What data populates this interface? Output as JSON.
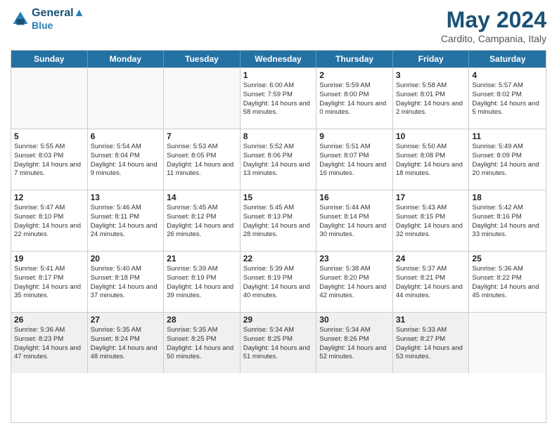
{
  "header": {
    "logo_line1": "General",
    "logo_line2": "Blue",
    "month_year": "May 2024",
    "location": "Cardito, Campania, Italy"
  },
  "days_of_week": [
    "Sunday",
    "Monday",
    "Tuesday",
    "Wednesday",
    "Thursday",
    "Friday",
    "Saturday"
  ],
  "weeks": [
    [
      {
        "day": "",
        "info": ""
      },
      {
        "day": "",
        "info": ""
      },
      {
        "day": "",
        "info": ""
      },
      {
        "day": "1",
        "info": "Sunrise: 6:00 AM\nSunset: 7:59 PM\nDaylight: 14 hours\nand 58 minutes."
      },
      {
        "day": "2",
        "info": "Sunrise: 5:59 AM\nSunset: 8:00 PM\nDaylight: 14 hours\nand 0 minutes."
      },
      {
        "day": "3",
        "info": "Sunrise: 5:58 AM\nSunset: 8:01 PM\nDaylight: 14 hours\nand 2 minutes."
      },
      {
        "day": "4",
        "info": "Sunrise: 5:57 AM\nSunset: 8:02 PM\nDaylight: 14 hours\nand 5 minutes."
      }
    ],
    [
      {
        "day": "5",
        "info": "Sunrise: 5:55 AM\nSunset: 8:03 PM\nDaylight: 14 hours\nand 7 minutes."
      },
      {
        "day": "6",
        "info": "Sunrise: 5:54 AM\nSunset: 8:04 PM\nDaylight: 14 hours\nand 9 minutes."
      },
      {
        "day": "7",
        "info": "Sunrise: 5:53 AM\nSunset: 8:05 PM\nDaylight: 14 hours\nand 11 minutes."
      },
      {
        "day": "8",
        "info": "Sunrise: 5:52 AM\nSunset: 8:06 PM\nDaylight: 14 hours\nand 13 minutes."
      },
      {
        "day": "9",
        "info": "Sunrise: 5:51 AM\nSunset: 8:07 PM\nDaylight: 14 hours\nand 16 minutes."
      },
      {
        "day": "10",
        "info": "Sunrise: 5:50 AM\nSunset: 8:08 PM\nDaylight: 14 hours\nand 18 minutes."
      },
      {
        "day": "11",
        "info": "Sunrise: 5:49 AM\nSunset: 8:09 PM\nDaylight: 14 hours\nand 20 minutes."
      }
    ],
    [
      {
        "day": "12",
        "info": "Sunrise: 5:47 AM\nSunset: 8:10 PM\nDaylight: 14 hours\nand 22 minutes."
      },
      {
        "day": "13",
        "info": "Sunrise: 5:46 AM\nSunset: 8:11 PM\nDaylight: 14 hours\nand 24 minutes."
      },
      {
        "day": "14",
        "info": "Sunrise: 5:45 AM\nSunset: 8:12 PM\nDaylight: 14 hours\nand 26 minutes."
      },
      {
        "day": "15",
        "info": "Sunrise: 5:45 AM\nSunset: 8:13 PM\nDaylight: 14 hours\nand 28 minutes."
      },
      {
        "day": "16",
        "info": "Sunrise: 5:44 AM\nSunset: 8:14 PM\nDaylight: 14 hours\nand 30 minutes."
      },
      {
        "day": "17",
        "info": "Sunrise: 5:43 AM\nSunset: 8:15 PM\nDaylight: 14 hours\nand 32 minutes."
      },
      {
        "day": "18",
        "info": "Sunrise: 5:42 AM\nSunset: 8:16 PM\nDaylight: 14 hours\nand 33 minutes."
      }
    ],
    [
      {
        "day": "19",
        "info": "Sunrise: 5:41 AM\nSunset: 8:17 PM\nDaylight: 14 hours\nand 35 minutes."
      },
      {
        "day": "20",
        "info": "Sunrise: 5:40 AM\nSunset: 8:18 PM\nDaylight: 14 hours\nand 37 minutes."
      },
      {
        "day": "21",
        "info": "Sunrise: 5:39 AM\nSunset: 8:19 PM\nDaylight: 14 hours\nand 39 minutes."
      },
      {
        "day": "22",
        "info": "Sunrise: 5:39 AM\nSunset: 8:19 PM\nDaylight: 14 hours\nand 40 minutes."
      },
      {
        "day": "23",
        "info": "Sunrise: 5:38 AM\nSunset: 8:20 PM\nDaylight: 14 hours\nand 42 minutes."
      },
      {
        "day": "24",
        "info": "Sunrise: 5:37 AM\nSunset: 8:21 PM\nDaylight: 14 hours\nand 44 minutes."
      },
      {
        "day": "25",
        "info": "Sunrise: 5:36 AM\nSunset: 8:22 PM\nDaylight: 14 hours\nand 45 minutes."
      }
    ],
    [
      {
        "day": "26",
        "info": "Sunrise: 5:36 AM\nSunset: 8:23 PM\nDaylight: 14 hours\nand 47 minutes."
      },
      {
        "day": "27",
        "info": "Sunrise: 5:35 AM\nSunset: 8:24 PM\nDaylight: 14 hours\nand 48 minutes."
      },
      {
        "day": "28",
        "info": "Sunrise: 5:35 AM\nSunset: 8:25 PM\nDaylight: 14 hours\nand 50 minutes."
      },
      {
        "day": "29",
        "info": "Sunrise: 5:34 AM\nSunset: 8:25 PM\nDaylight: 14 hours\nand 51 minutes."
      },
      {
        "day": "30",
        "info": "Sunrise: 5:34 AM\nSunset: 8:26 PM\nDaylight: 14 hours\nand 52 minutes."
      },
      {
        "day": "31",
        "info": "Sunrise: 5:33 AM\nSunset: 8:27 PM\nDaylight: 14 hours\nand 53 minutes."
      },
      {
        "day": "",
        "info": ""
      }
    ]
  ]
}
